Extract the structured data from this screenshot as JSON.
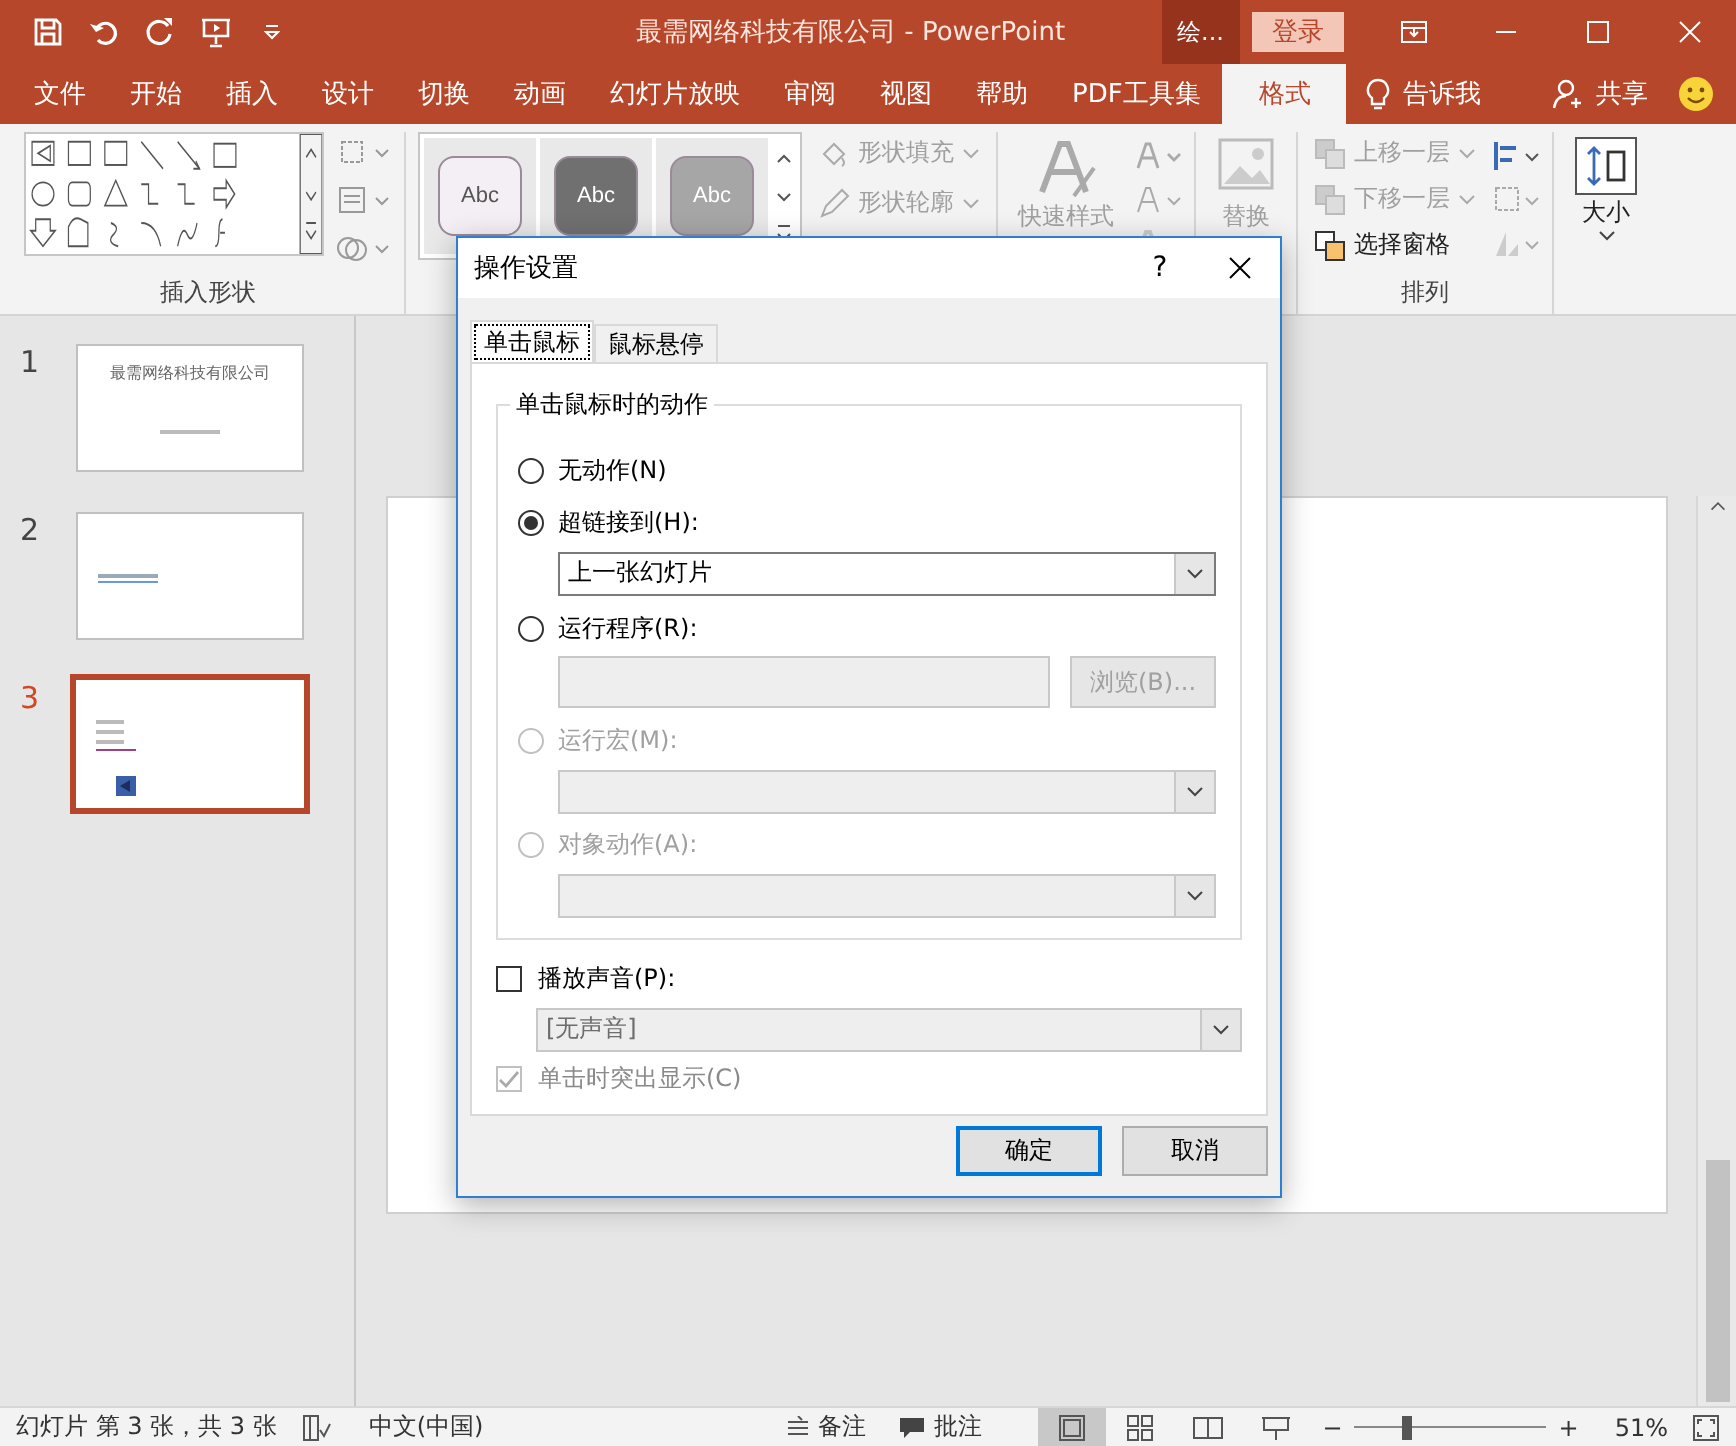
{
  "window": {
    "title": "最需网络科技有限公司  -  PowerPoint",
    "context_tab": "绘...",
    "sign_in": "登录"
  },
  "ribbon_tabs": [
    {
      "label": "文件",
      "selected": false
    },
    {
      "label": "开始",
      "selected": false
    },
    {
      "label": "插入",
      "selected": false
    },
    {
      "label": "设计",
      "selected": false
    },
    {
      "label": "切换",
      "selected": false
    },
    {
      "label": "动画",
      "selected": false
    },
    {
      "label": "幻灯片放映",
      "selected": false
    },
    {
      "label": "审阅",
      "selected": false
    },
    {
      "label": "视图",
      "selected": false
    },
    {
      "label": "帮助",
      "selected": false
    },
    {
      "label": "PDF工具集",
      "selected": false
    },
    {
      "label": "格式",
      "selected": true
    }
  ],
  "tell_me": "告诉我",
  "share": "共享",
  "ribbon": {
    "insert_shapes_label": "插入形状",
    "shape_styles": [
      {
        "label": "Abc",
        "color": "#f4eff4"
      },
      {
        "label": "Abc",
        "color": "#707070"
      },
      {
        "label": "Abc",
        "color": "#a6a6a6"
      }
    ],
    "fill": {
      "label": "形状填充",
      "disabled": true
    },
    "outline": {
      "label": "形状轮廓",
      "disabled": true
    },
    "quick_styles": {
      "label": "快速样式",
      "disabled": true
    },
    "replace": {
      "label": "替换",
      "disabled": true
    },
    "arrange_commands": [
      {
        "label": "上移一层",
        "disabled": true
      },
      {
        "label": "下移一层",
        "disabled": true
      },
      {
        "label": "选择窗格",
        "disabled": false
      }
    ],
    "arrange_label": "排列",
    "size": {
      "label": "大小",
      "disabled": false
    }
  },
  "slides": [
    {
      "number": "1",
      "selected": false,
      "title": "最需网络科技有限公司"
    },
    {
      "number": "2",
      "selected": false
    },
    {
      "number": "3",
      "selected": true
    }
  ],
  "dialog": {
    "title": "操作设置",
    "help": "?",
    "tabs": [
      {
        "label": "单击鼠标",
        "selected": true
      },
      {
        "label": "鼠标悬停",
        "selected": false
      }
    ],
    "group_title": "单击鼠标时的动作",
    "options": [
      {
        "label": "无动作(N)",
        "selected": false,
        "disabled": false
      },
      {
        "label": "超链接到(H):",
        "selected": true,
        "disabled": false,
        "field": {
          "kind": "dropdown",
          "value": "上一张幻灯片",
          "disabled": false
        }
      },
      {
        "label": "运行程序(R):",
        "selected": false,
        "disabled": false,
        "field": {
          "kind": "input",
          "disabled": true,
          "button": "浏览(B)..."
        }
      },
      {
        "label": "运行宏(M):",
        "selected": false,
        "disabled": true,
        "field": {
          "kind": "dropdown",
          "disabled": true
        }
      },
      {
        "label": "对象动作(A):",
        "selected": false,
        "disabled": true,
        "field": {
          "kind": "dropdown",
          "disabled": true
        }
      }
    ],
    "sound": {
      "label": "播放声音(P):",
      "checked": false,
      "value": "[无声音]",
      "disabled": true
    },
    "highlight": {
      "label": "单击时突出显示(C)",
      "checked": true,
      "disabled": true
    },
    "buttons": [
      {
        "label": "确定",
        "default": true
      },
      {
        "label": "取消",
        "default": false
      }
    ]
  },
  "status_bar": {
    "slide_info": "幻灯片 第 3 张，共 3 张",
    "language": "中文(中国)",
    "notes": "备注",
    "comments": "批注",
    "views": [
      {
        "selected": true
      },
      {
        "selected": false
      },
      {
        "selected": false
      },
      {
        "selected": false
      }
    ],
    "zoom_out": "−",
    "zoom_in": "+",
    "zoom": {
      "level": 0.25
    },
    "zoom_value": "51%"
  }
}
